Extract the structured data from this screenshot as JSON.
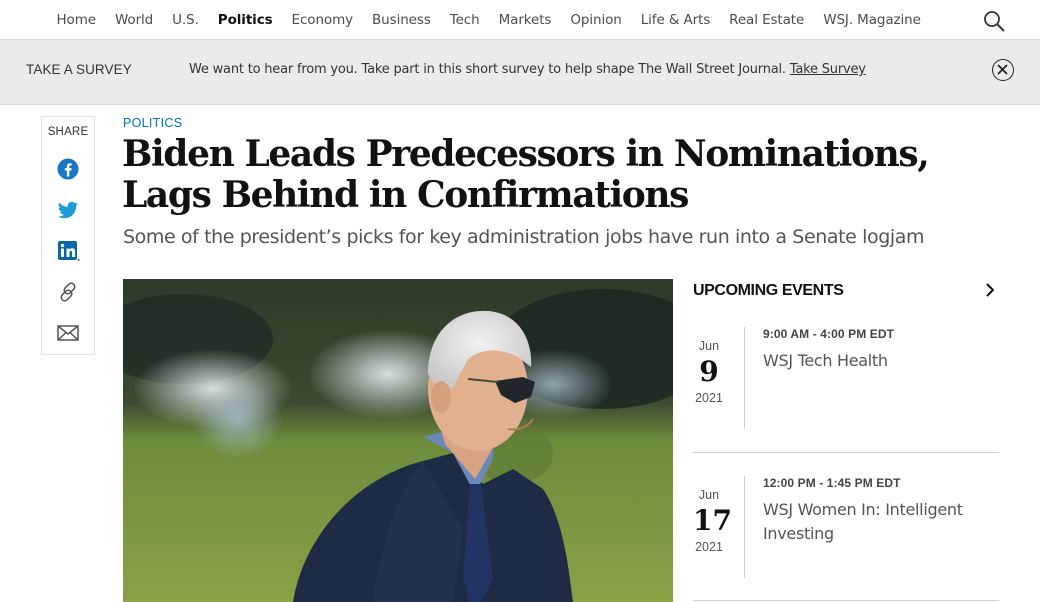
{
  "nav": {
    "items": [
      {
        "label": "Home"
      },
      {
        "label": "World"
      },
      {
        "label": "U.S."
      },
      {
        "label": "Politics"
      },
      {
        "label": "Economy"
      },
      {
        "label": "Business"
      },
      {
        "label": "Tech"
      },
      {
        "label": "Markets"
      },
      {
        "label": "Opinion"
      },
      {
        "label": "Life & Arts"
      },
      {
        "label": "Real Estate"
      },
      {
        "label": "WSJ. Magazine"
      }
    ],
    "active_item": "Politics",
    "search_icon": "search-icon"
  },
  "survey": {
    "label": "TAKE A SURVEY",
    "message": "We want to hear from you. Take part in this short survey to help shape The Wall Street Journal.",
    "link_text": "Take Survey",
    "close_icon": "close-icon"
  },
  "share": {
    "label": "SHARE",
    "icons": [
      "facebook-icon",
      "twitter-icon",
      "linkedin-icon",
      "link-icon",
      "email-icon"
    ]
  },
  "article": {
    "section": "POLITICS",
    "headline": "Biden Leads Predecessors in Nominations, Lags Behind in Confirmations",
    "dek": "Some of the president’s picks for key administration jobs have run into a Senate logjam"
  },
  "events": {
    "title": "UPCOMING EVENTS",
    "arrow_icon": "chevron-right-icon",
    "items": [
      {
        "month": "Jun",
        "day": "9",
        "year": "2021",
        "time": "9:00 AM - 4:00 PM EDT",
        "name": "WSJ Tech Health"
      },
      {
        "month": "Jun",
        "day": "17",
        "year": "2021",
        "time": "12:00 PM - 1:45 PM EDT",
        "name": "WSJ Women In: Intelligent Investing"
      }
    ]
  },
  "colors": {
    "accent_link": "#0274b6",
    "banner_bg": "#ebebeb",
    "headline": "#111111"
  }
}
